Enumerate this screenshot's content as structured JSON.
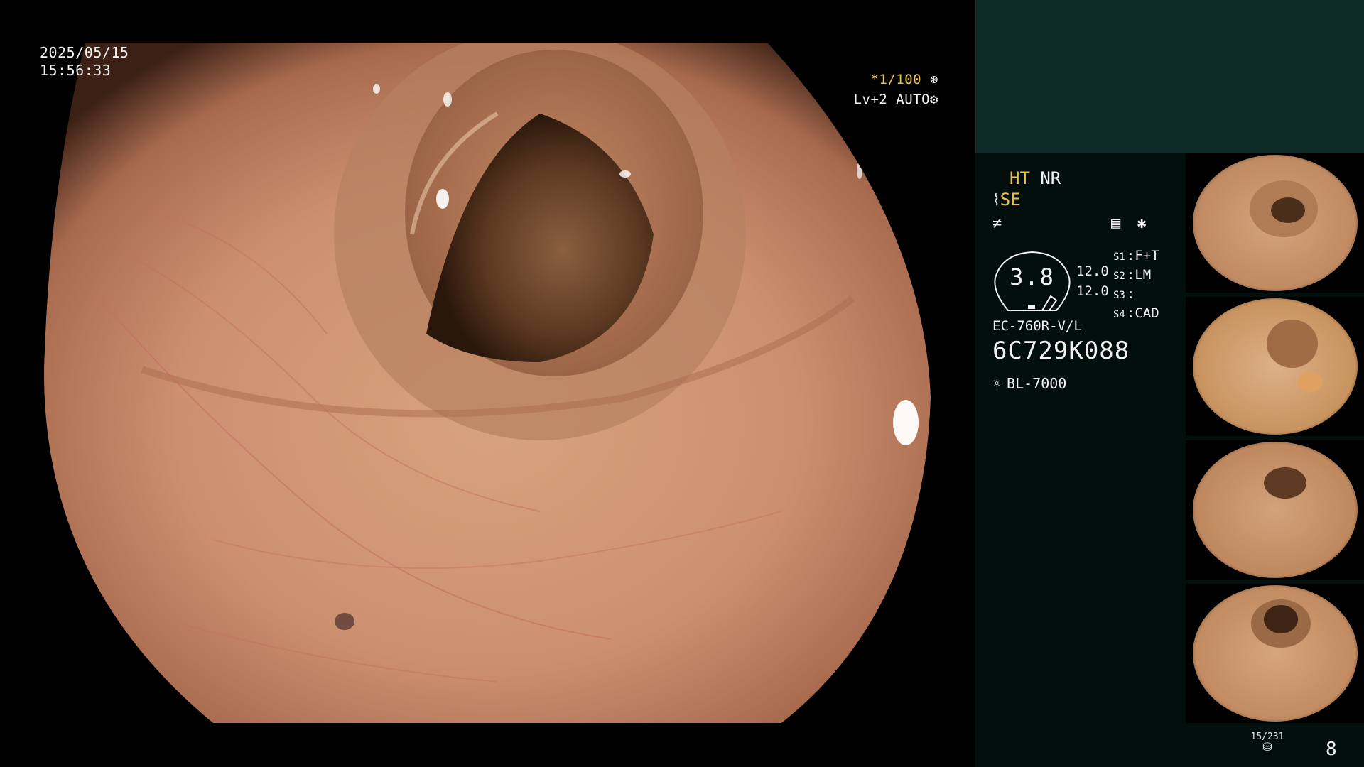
{
  "main_view": {
    "date": "2025/05/15",
    "time": "15:56:33",
    "shutter_prefix": "*",
    "shutter": "1/100",
    "level": "Lv+2",
    "mode": "AUTO"
  },
  "panel": {
    "ht": "HT",
    "nr": "NR",
    "se": "SE",
    "gauge_value": "3.8",
    "gain_1": "12.0",
    "gain_2": "12.0",
    "switches": [
      {
        "key": "S1",
        "value": "F+T"
      },
      {
        "key": "S2",
        "value": "LM"
      },
      {
        "key": "S3",
        "value": ""
      },
      {
        "key": "S4",
        "value": "CAD"
      }
    ],
    "scope_model": "EC-760R-V/L",
    "serial_number": "6C729K088",
    "light_source": "BL-7000",
    "image_counter": "15/231",
    "page_number": "8"
  },
  "icons": {
    "shutter": "aperture-icon",
    "mode": "gear-icon",
    "structure": "structure-enhance-icon",
    "filter": "filter-icon",
    "color": "color-chart-icon",
    "star": "asterisk-icon",
    "light": "lamp-icon",
    "storage": "storage-icon"
  },
  "colors": {
    "panel_bg": "#030f0d",
    "panel_top": "#0f2b27",
    "highlight": "#f0c14a",
    "text": "#f2f2f2"
  }
}
